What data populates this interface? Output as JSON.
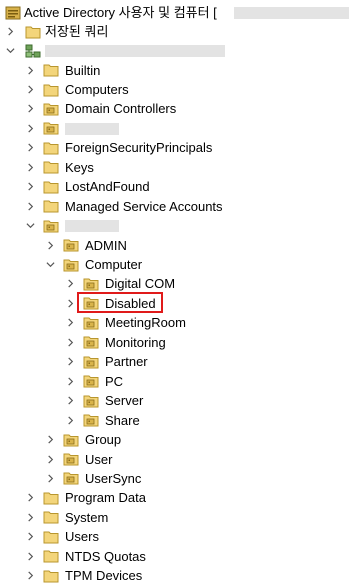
{
  "root": {
    "label": "Active Directory 사용자 및 컴퓨터 [",
    "icon": "ad-console-icon"
  },
  "saved_queries": {
    "label": "저장된 쿼리",
    "icon": "folder-icon"
  },
  "domain": {
    "label": "",
    "icon": "domain-tree-icon"
  },
  "domain_children": [
    {
      "label": "Builtin",
      "icon": "folder-icon"
    },
    {
      "label": "Computers",
      "icon": "folder-icon"
    },
    {
      "label": "Domain Controllers",
      "icon": "ou-folder-icon"
    },
    {
      "label": "",
      "icon": "ou-folder-icon"
    },
    {
      "label": "ForeignSecurityPrincipals",
      "icon": "folder-icon"
    },
    {
      "label": "Keys",
      "icon": "folder-icon"
    },
    {
      "label": "LostAndFound",
      "icon": "folder-icon"
    },
    {
      "label": "Managed Service Accounts",
      "icon": "folder-icon"
    },
    {
      "label": "",
      "icon": "ou-folder-icon"
    }
  ],
  "ou_children": [
    {
      "label": "ADMIN",
      "icon": "ou-folder-icon"
    },
    {
      "label": "Computer",
      "icon": "ou-folder-icon"
    }
  ],
  "computer_children": [
    {
      "label": "Digital COM",
      "icon": "ou-folder-icon"
    },
    {
      "label": "Disabled",
      "icon": "ou-folder-icon",
      "selected": true
    },
    {
      "label": "MeetingRoom",
      "icon": "ou-folder-icon"
    },
    {
      "label": "Monitoring",
      "icon": "ou-folder-icon"
    },
    {
      "label": "Partner",
      "icon": "ou-folder-icon"
    },
    {
      "label": "PC",
      "icon": "ou-folder-icon"
    },
    {
      "label": "Server",
      "icon": "ou-folder-icon"
    },
    {
      "label": "Share",
      "icon": "ou-folder-icon"
    }
  ],
  "ou_children_after": [
    {
      "label": "Group",
      "icon": "ou-folder-icon"
    },
    {
      "label": "User",
      "icon": "ou-folder-icon"
    },
    {
      "label": "UserSync",
      "icon": "ou-folder-icon"
    }
  ],
  "domain_children_after": [
    {
      "label": "Program Data",
      "icon": "folder-icon"
    },
    {
      "label": "System",
      "icon": "folder-icon"
    },
    {
      "label": "Users",
      "icon": "folder-icon"
    },
    {
      "label": "NTDS Quotas",
      "icon": "folder-icon"
    },
    {
      "label": "TPM Devices",
      "icon": "folder-icon"
    }
  ],
  "colors": {
    "selection_outline": "#e01a1a",
    "folder": "#e8c45a",
    "redaction": "#e3e3e3"
  }
}
